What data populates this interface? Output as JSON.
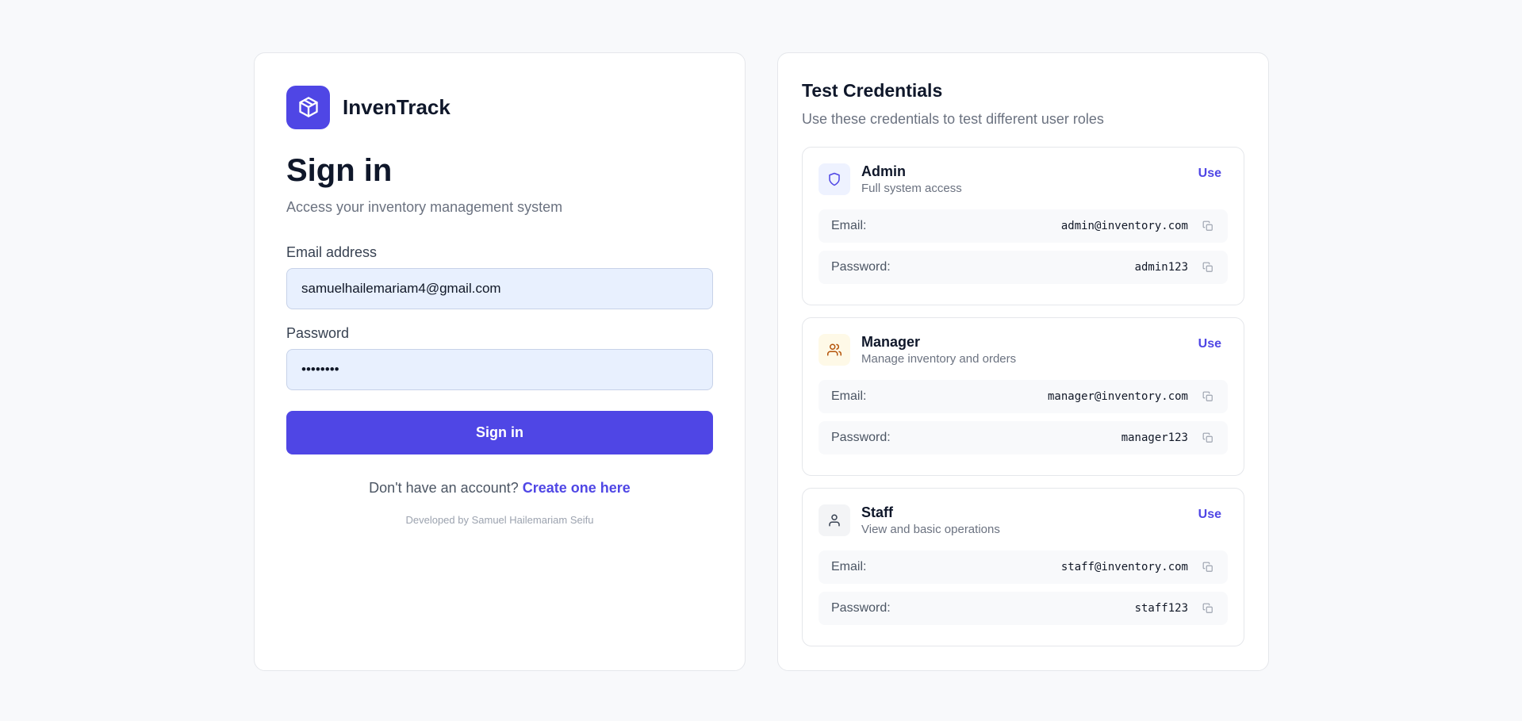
{
  "colors": {
    "accent": "#4f46e5",
    "input_bg": "#e8f0fe",
    "page_bg": "#f8f9fb"
  },
  "brand": {
    "name": "InvenTrack",
    "logo_icon": "package-icon"
  },
  "login": {
    "title": "Sign in",
    "subtitle": "Access your inventory management system",
    "email_label": "Email address",
    "email_value": "samuelhailemariam4@gmail.com",
    "password_label": "Password",
    "password_value": "••••••••",
    "submit_label": "Sign in",
    "signup_prompt": "Don't have an account?",
    "signup_link": "Create one here",
    "footer": "Developed by Samuel Hailemariam Seifu"
  },
  "credentials": {
    "title": "Test Credentials",
    "subtitle": "Use these credentials to test different user roles",
    "email_label": "Email:",
    "password_label": "Password:",
    "use_label": "Use",
    "roles": [
      {
        "name": "Admin",
        "description": "Full system access",
        "email": "admin@inventory.com",
        "password": "admin123",
        "icon": "shield-icon",
        "icon_color": "#4f46e5",
        "icon_bg": "#eef2ff"
      },
      {
        "name": "Manager",
        "description": "Manage inventory and orders",
        "email": "manager@inventory.com",
        "password": "manager123",
        "icon": "users-icon",
        "icon_color": "#b45309",
        "icon_bg": "#fef9e7"
      },
      {
        "name": "Staff",
        "description": "View and basic operations",
        "email": "staff@inventory.com",
        "password": "staff123",
        "icon": "user-icon",
        "icon_color": "#374151",
        "icon_bg": "#f3f4f6"
      }
    ]
  }
}
